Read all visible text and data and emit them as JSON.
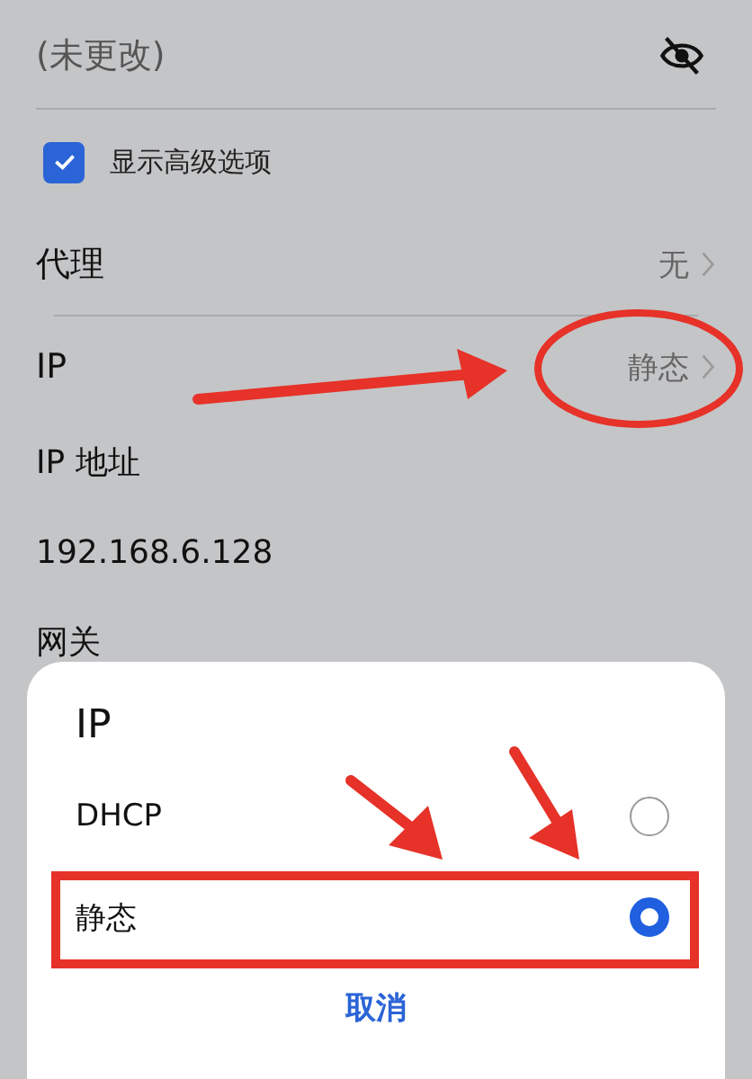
{
  "password_field": {
    "placeholder": "(未更改)",
    "visible": false
  },
  "advanced_options": {
    "label": "显示高级选项",
    "checked": true
  },
  "settings": [
    {
      "label": "代理",
      "value": "无"
    },
    {
      "label": "IP",
      "value": "静态"
    }
  ],
  "ip_address": {
    "label": "IP 地址",
    "value": "192.168.6.128"
  },
  "gateway": {
    "label": "网关"
  },
  "dialog": {
    "title": "IP",
    "options": [
      {
        "label": "DHCP",
        "selected": false
      },
      {
        "label": "静态",
        "selected": true
      }
    ],
    "cancel": "取消"
  }
}
